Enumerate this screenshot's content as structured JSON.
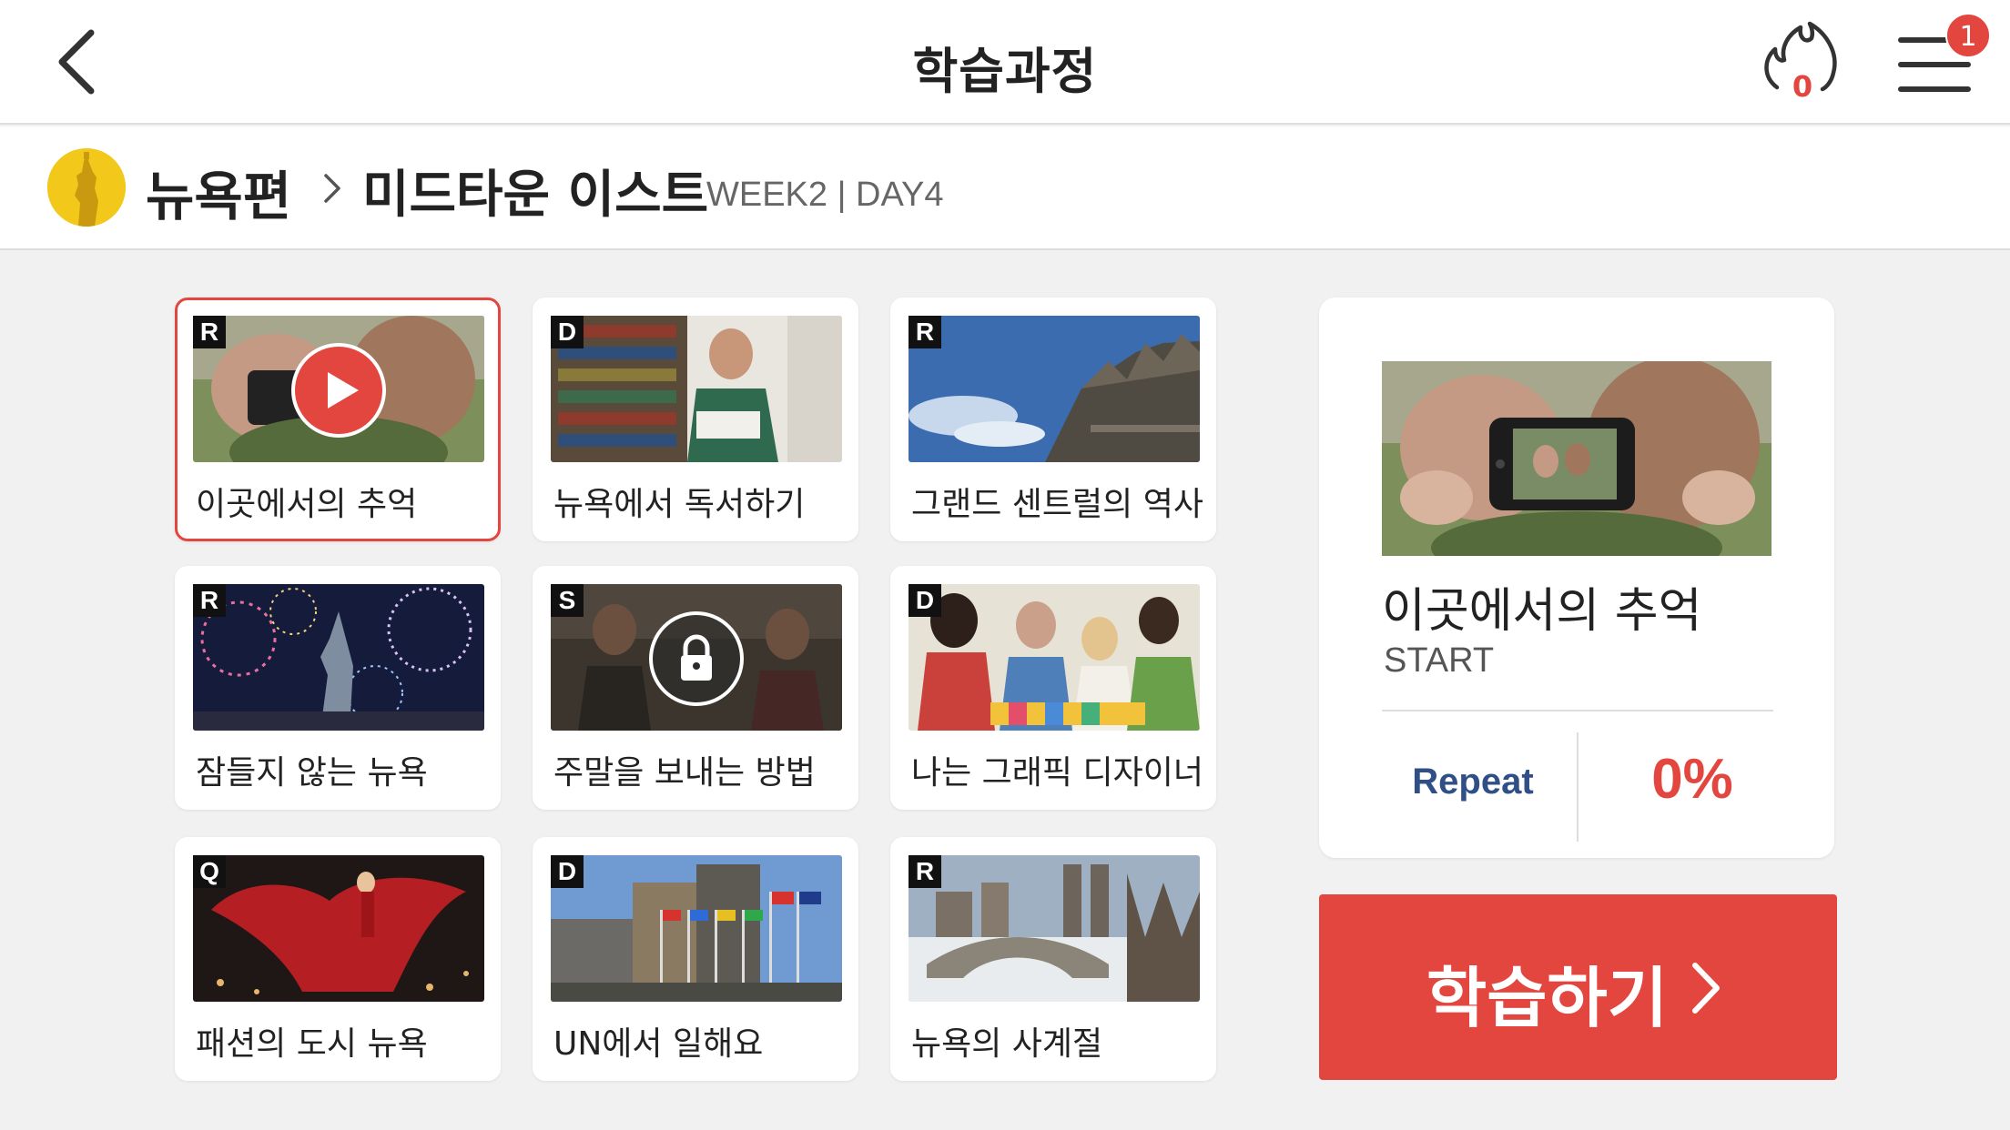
{
  "header": {
    "title": "학습과정",
    "streak_count": "0",
    "menu_badge": "1"
  },
  "breadcrumb": {
    "course": "뉴욕편",
    "lesson": "미드타운 이스트",
    "week_day": "WEEK2 | DAY4"
  },
  "lessons": [
    {
      "type": "R",
      "title": "이곳에서의 추억",
      "state": "selected",
      "overlay": "play-icon"
    },
    {
      "type": "D",
      "title": "뉴욕에서 독서하기"
    },
    {
      "type": "R",
      "title": "그랜드 센트럴의 역사"
    },
    {
      "type": "R",
      "title": "잠들지 않는 뉴욕"
    },
    {
      "type": "S",
      "title": "주말을 보내는 방법",
      "state": "locked",
      "overlay": "lock-icon"
    },
    {
      "type": "D",
      "title": "나는 그래픽 디자이너"
    },
    {
      "type": "Q",
      "title": "패션의 도시 뉴욕"
    },
    {
      "type": "D",
      "title": "UN에서 일해요"
    },
    {
      "type": "R",
      "title": "뉴욕의 사계절"
    }
  ],
  "detail": {
    "title": "이곳에서의 추억",
    "status": "START",
    "repeat_label": "Repeat",
    "progress": "0%"
  },
  "study_button": {
    "label": "학습하기"
  },
  "colors": {
    "accent": "#e2463f",
    "repeat": "#2f4f86",
    "background": "#f1f1f1"
  }
}
